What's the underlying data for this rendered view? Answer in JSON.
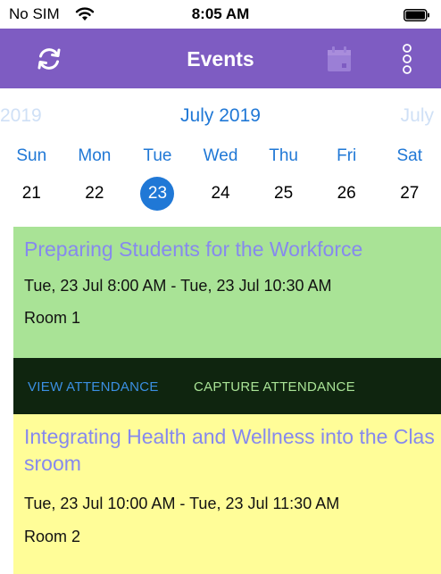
{
  "status_bar": {
    "carrier": "No SIM",
    "time": "8:05 AM",
    "wifi_icon": "wifi-icon",
    "battery_icon": "battery-icon"
  },
  "nav": {
    "title": "Events",
    "refresh_icon": "refresh-icon",
    "calendar_icon": "calendar-icon",
    "more_icon": "more-vertical-icon",
    "background_color": "#7e5cc2"
  },
  "calendar": {
    "prev_month": "2019",
    "current_month": "July 2019",
    "next_month": "July",
    "weekdays": [
      "Sun",
      "Mon",
      "Tue",
      "Wed",
      "Thu",
      "Fri",
      "Sat"
    ],
    "days": [
      "21",
      "22",
      "23",
      "24",
      "25",
      "26",
      "27"
    ],
    "selected_day": "23",
    "accent_color": "#2078d6"
  },
  "events": [
    {
      "title": "Preparing Students for the Workforce",
      "time": "Tue, 23 Jul 8:00 AM - Tue, 23 Jul 10:30 AM",
      "room": "Room 1",
      "background_color": "#a9e396"
    },
    {
      "title": "Integrating Health and Wellness into the Classroom",
      "time": "Tue, 23 Jul 10:00 AM - Tue, 23 Jul 11:30 AM",
      "room": "Room 2",
      "background_color": "#fffd98"
    }
  ],
  "actions": {
    "view_attendance": "VIEW ATTENDANCE",
    "capture_attendance": "CAPTURE ATTENDANCE"
  }
}
